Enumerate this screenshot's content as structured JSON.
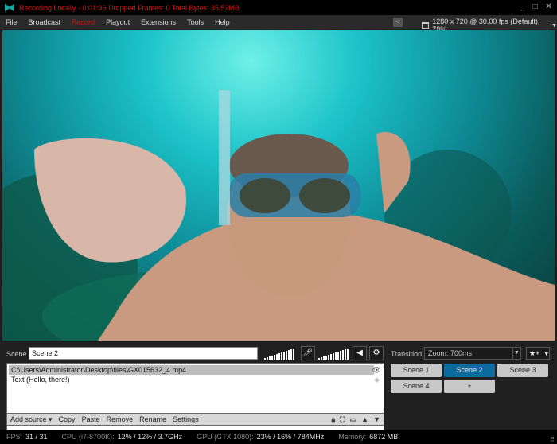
{
  "titlebar": {
    "status": "Recording Locally - 0:01:36  Dropped Frames: 0  Total Bytes: 35.52MB",
    "buttons": [
      "_",
      "□",
      "✕"
    ]
  },
  "menu": {
    "items": [
      "File",
      "Broadcast",
      "Record",
      "Playout",
      "Extensions",
      "Tools",
      "Help"
    ],
    "active": "Record",
    "resolution": "1280 x 720 @ 30.00 fps (Default), 78%"
  },
  "scene": {
    "label": "Scene",
    "name": "Scene 2"
  },
  "sources": {
    "items": [
      "C:\\Users\\Administrator\\Desktop\\files\\GX015632_4.mp4",
      "Text (Hello, there!)"
    ],
    "toolbar": [
      "Add source ▾",
      "Copy",
      "Paste",
      "Remove",
      "Rename",
      "Settings"
    ]
  },
  "transition": {
    "label": "Transition",
    "value": "Zoom: 700ms"
  },
  "scenes": [
    "Scene 1",
    "Scene 2",
    "Scene 3",
    "Scene 4",
    "+"
  ],
  "active_scene": "Scene 2",
  "status": {
    "fps_label": "FPS:",
    "fps": "31 / 31",
    "cpu_label": "CPU (i7-8700K):",
    "cpu": "12% / 12% / 3.7GHz",
    "gpu_label": "GPU (GTX 1080):",
    "gpu": "23% / 16% / 784MHz",
    "mem_label": "Memory:",
    "mem": "6872 MB"
  },
  "colors": {
    "accent": "#0b6a9e",
    "recording": "#d41414"
  }
}
